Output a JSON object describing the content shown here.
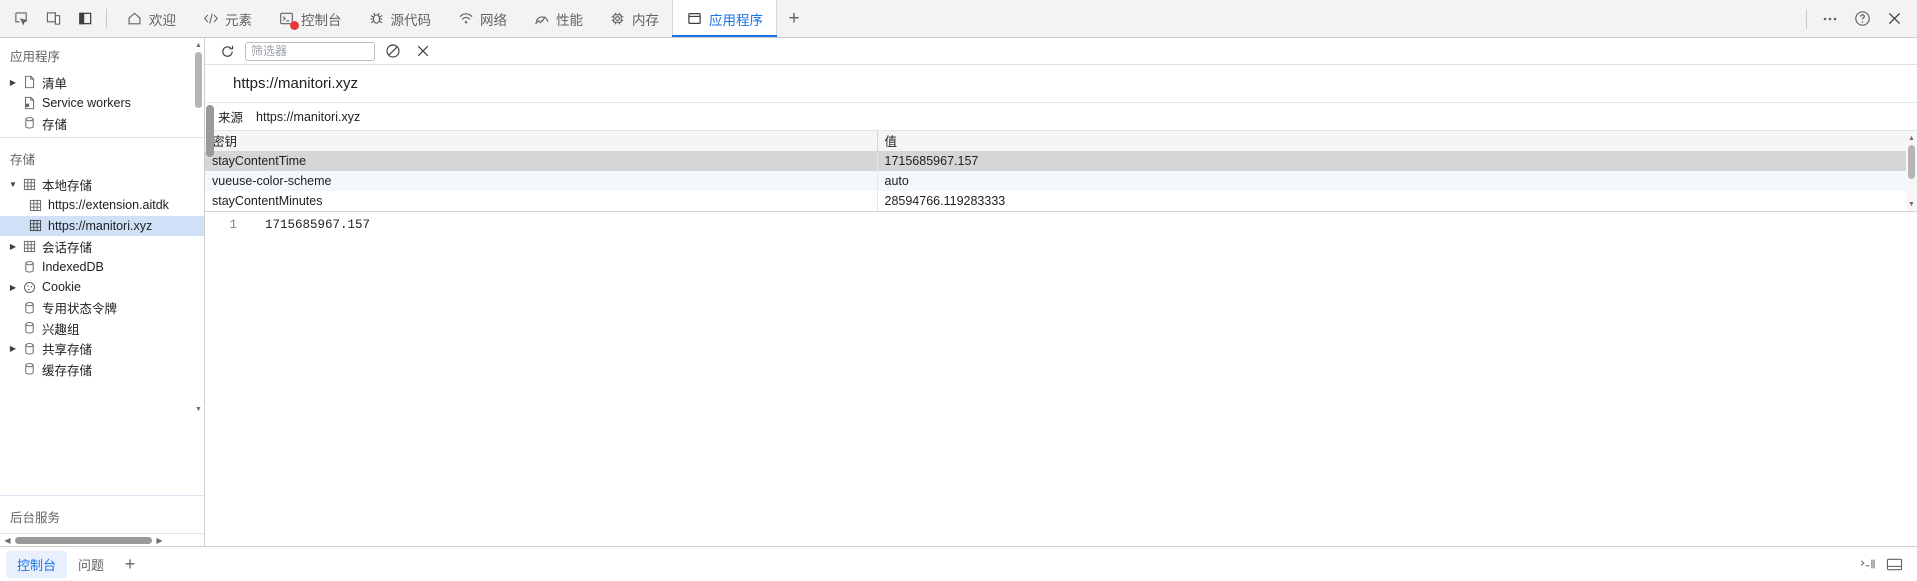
{
  "window": {
    "dock_buttons": [
      {
        "name": "inspect-element-icon",
        "title": "检查元素"
      },
      {
        "name": "device-toolbar-icon",
        "title": "设备工具栏"
      },
      {
        "name": "dock-side-icon",
        "title": "停靠位置"
      }
    ],
    "top_right": [
      {
        "name": "more-options-icon",
        "glyph": "⋯"
      },
      {
        "name": "help-icon",
        "glyph": "?"
      },
      {
        "name": "close-icon",
        "glyph": "✕"
      }
    ]
  },
  "tabs": [
    {
      "label": "欢迎",
      "icon": "home-icon",
      "active": false,
      "error": false
    },
    {
      "label": "元素",
      "icon": "code-icon",
      "active": false,
      "error": false
    },
    {
      "label": "控制台",
      "icon": "console-icon",
      "active": false,
      "error": true
    },
    {
      "label": "源代码",
      "icon": "bug-icon",
      "active": false,
      "error": false
    },
    {
      "label": "网络",
      "icon": "network-icon",
      "active": false,
      "error": false
    },
    {
      "label": "性能",
      "icon": "performance-icon",
      "active": false,
      "error": false
    },
    {
      "label": "内存",
      "icon": "memory-icon",
      "active": false,
      "error": false
    },
    {
      "label": "应用程序",
      "icon": "application-icon",
      "active": true,
      "error": false
    }
  ],
  "add_tab_label": "+",
  "sidebar": {
    "section_application": {
      "title": "应用程序",
      "items": [
        {
          "label": "清单",
          "icon": "manifest-icon",
          "expandable": true,
          "expanded": false,
          "indent": 1,
          "selected": false
        },
        {
          "label": "Service workers",
          "icon": "service-worker-icon",
          "expandable": false,
          "expanded": false,
          "indent": 1,
          "selected": false
        },
        {
          "label": "存储",
          "icon": "database-icon",
          "expandable": false,
          "expanded": false,
          "indent": 1,
          "selected": false
        }
      ]
    },
    "section_storage": {
      "title": "存储",
      "items": [
        {
          "label": "本地存储",
          "icon": "table-icon",
          "expandable": true,
          "expanded": true,
          "indent": 1,
          "selected": false
        },
        {
          "label": "https://extension.aitdk",
          "icon": "table-icon",
          "expandable": false,
          "expanded": false,
          "indent": 2,
          "selected": false
        },
        {
          "label": "https://manitori.xyz",
          "icon": "table-icon",
          "expandable": false,
          "expanded": false,
          "indent": 2,
          "selected": true
        },
        {
          "label": "会话存储",
          "icon": "table-icon",
          "expandable": true,
          "expanded": false,
          "indent": 1,
          "selected": false
        },
        {
          "label": "IndexedDB",
          "icon": "database-icon",
          "expandable": false,
          "expanded": false,
          "indent": 1,
          "selected": false
        },
        {
          "label": "Cookie",
          "icon": "cookie-icon",
          "expandable": true,
          "expanded": false,
          "indent": 1,
          "selected": false
        },
        {
          "label": "专用状态令牌",
          "icon": "database-icon",
          "expandable": false,
          "expanded": false,
          "indent": 1,
          "selected": false
        },
        {
          "label": "兴趣组",
          "icon": "database-icon",
          "expandable": false,
          "expanded": false,
          "indent": 1,
          "selected": false
        },
        {
          "label": "共享存储",
          "icon": "database-icon",
          "expandable": true,
          "expanded": false,
          "indent": 1,
          "selected": false
        },
        {
          "label": "缓存存储",
          "icon": "database-icon",
          "expandable": false,
          "expanded": false,
          "indent": 1,
          "selected": false
        }
      ]
    },
    "section_background": {
      "title": "后台服务"
    }
  },
  "toolbar": {
    "refresh_icon": "refresh-icon",
    "filter_placeholder": "筛选器",
    "filter_value": "",
    "clear_all_icon": "clear-all-icon",
    "delete_selected_icon": "delete-selected-icon"
  },
  "panel": {
    "url_title": "https://manitori.xyz",
    "origin_label": "来源",
    "origin_value": "https://manitori.xyz"
  },
  "table": {
    "columns": [
      "密钥",
      "值"
    ],
    "rows": [
      {
        "key": "stayContentTime",
        "value": "1715685967.157",
        "selected": true
      },
      {
        "key": "vueuse-color-scheme",
        "value": "auto",
        "selected": false
      },
      {
        "key": "stayContentMinutes",
        "value": "28594766.119283333",
        "selected": false
      }
    ]
  },
  "preview": {
    "line_number": "1",
    "content": "1715685967.157"
  },
  "drawer": {
    "tabs": [
      {
        "label": "控制台",
        "active": true
      },
      {
        "label": "问题",
        "active": false
      }
    ],
    "add_label": "+",
    "right_icons": [
      {
        "name": "console-settings-icon"
      },
      {
        "name": "drawer-dock-icon"
      }
    ]
  },
  "colors": {
    "accent": "#1a73e8",
    "selection_blue": "#cfe0f7",
    "row_selected": "#d6d6d6",
    "error_red": "#e53935"
  }
}
